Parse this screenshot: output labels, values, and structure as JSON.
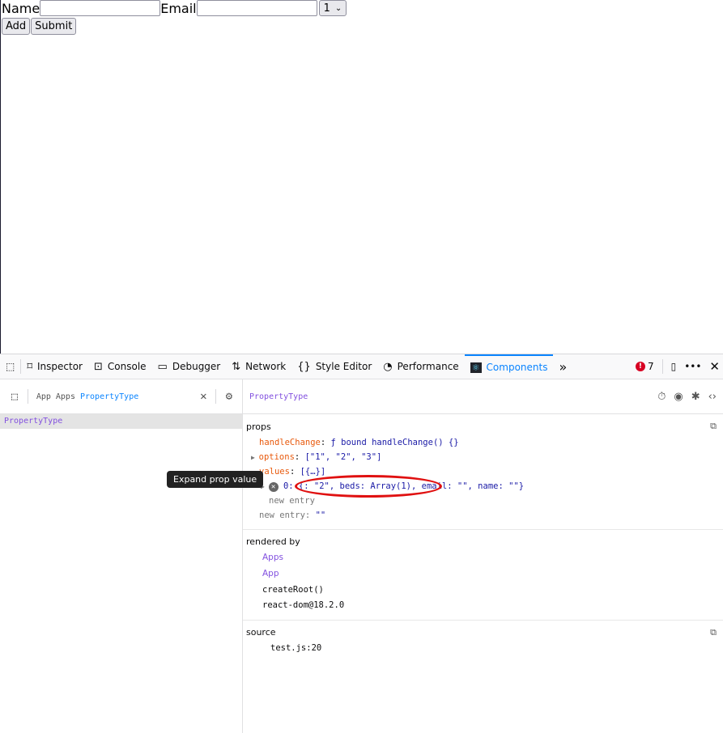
{
  "form": {
    "name_label": "Name",
    "name_value": "",
    "email_label": "Email",
    "email_value": "",
    "select_value": "1",
    "add_label": "Add",
    "submit_label": "Submit"
  },
  "toolbar": {
    "tabs": [
      {
        "label": "Inspector",
        "icon": "inspector-icon"
      },
      {
        "label": "Console",
        "icon": "console-icon"
      },
      {
        "label": "Debugger",
        "icon": "debugger-icon"
      },
      {
        "label": "Network",
        "icon": "network-icon"
      },
      {
        "label": "Style Editor",
        "icon": "style-editor-icon"
      },
      {
        "label": "Performance",
        "icon": "performance-icon"
      },
      {
        "label": "Components",
        "icon": "react-icon",
        "active": true
      }
    ],
    "error_count": "7",
    "accent": "#0a84ff"
  },
  "tree": {
    "breadcrumb": [
      "App",
      "Apps",
      "PropertyType"
    ],
    "selected": "PropertyType"
  },
  "inspector": {
    "component": "PropertyType",
    "props_title": "props",
    "props": {
      "handleChange_key": "handleChange",
      "handleChange_val": "ƒ bound handleChange() {}",
      "options_key": "options",
      "options_val": "[\"1\", \"2\", \"3\"]",
      "values_key": "values",
      "values_val": "[{…}]",
      "entry0": "0: {: \"2\", beds: Array(1), email: \"\", name: \"\"}",
      "new_entry_inner": "new entry",
      "new_entry_key": "new entry",
      "new_entry_val": "\"\""
    },
    "rendered_by_title": "rendered by",
    "rendered_by": [
      "Apps",
      "App",
      "createRoot()",
      "react-dom@18.2.0"
    ],
    "source_title": "source",
    "source": "test.js:20"
  },
  "tooltip": "Expand prop value",
  "annotation_color": "#e01010"
}
